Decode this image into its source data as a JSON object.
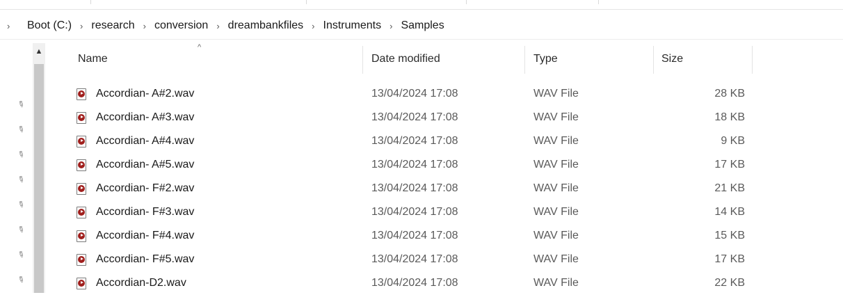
{
  "breadcrumb": {
    "lead": "›",
    "separator": "›",
    "items": [
      "Boot (C:)",
      "research",
      "conversion",
      "dreambankfiles",
      "Instruments",
      "Samples"
    ]
  },
  "scrollbar": {
    "up_arrow": "▲"
  },
  "columns": {
    "name": "Name",
    "date": "Date modified",
    "type": "Type",
    "size": "Size",
    "sort_indicator": "^"
  },
  "files": [
    {
      "name": "Accordian- A#2.wav",
      "date": "13/04/2024 17:08",
      "type": "WAV File",
      "size": "28 KB"
    },
    {
      "name": "Accordian- A#3.wav",
      "date": "13/04/2024 17:08",
      "type": "WAV File",
      "size": "18 KB"
    },
    {
      "name": "Accordian- A#4.wav",
      "date": "13/04/2024 17:08",
      "type": "WAV File",
      "size": "9 KB"
    },
    {
      "name": "Accordian- A#5.wav",
      "date": "13/04/2024 17:08",
      "type": "WAV File",
      "size": "17 KB"
    },
    {
      "name": "Accordian- F#2.wav",
      "date": "13/04/2024 17:08",
      "type": "WAV File",
      "size": "21 KB"
    },
    {
      "name": "Accordian- F#3.wav",
      "date": "13/04/2024 17:08",
      "type": "WAV File",
      "size": "14 KB"
    },
    {
      "name": "Accordian- F#4.wav",
      "date": "13/04/2024 17:08",
      "type": "WAV File",
      "size": "15 KB"
    },
    {
      "name": "Accordian- F#5.wav",
      "date": "13/04/2024 17:08",
      "type": "WAV File",
      "size": "17 KB"
    },
    {
      "name": "Accordian-D2.wav",
      "date": "13/04/2024 17:08",
      "type": "WAV File",
      "size": "22 KB"
    }
  ],
  "icons": {
    "file": "wav-file-icon",
    "pin": "pin-icon"
  },
  "colors": {
    "wav_icon": "#a0201e",
    "scroll_track": "#f0f0f0",
    "scroll_thumb": "#c8c8c8"
  }
}
